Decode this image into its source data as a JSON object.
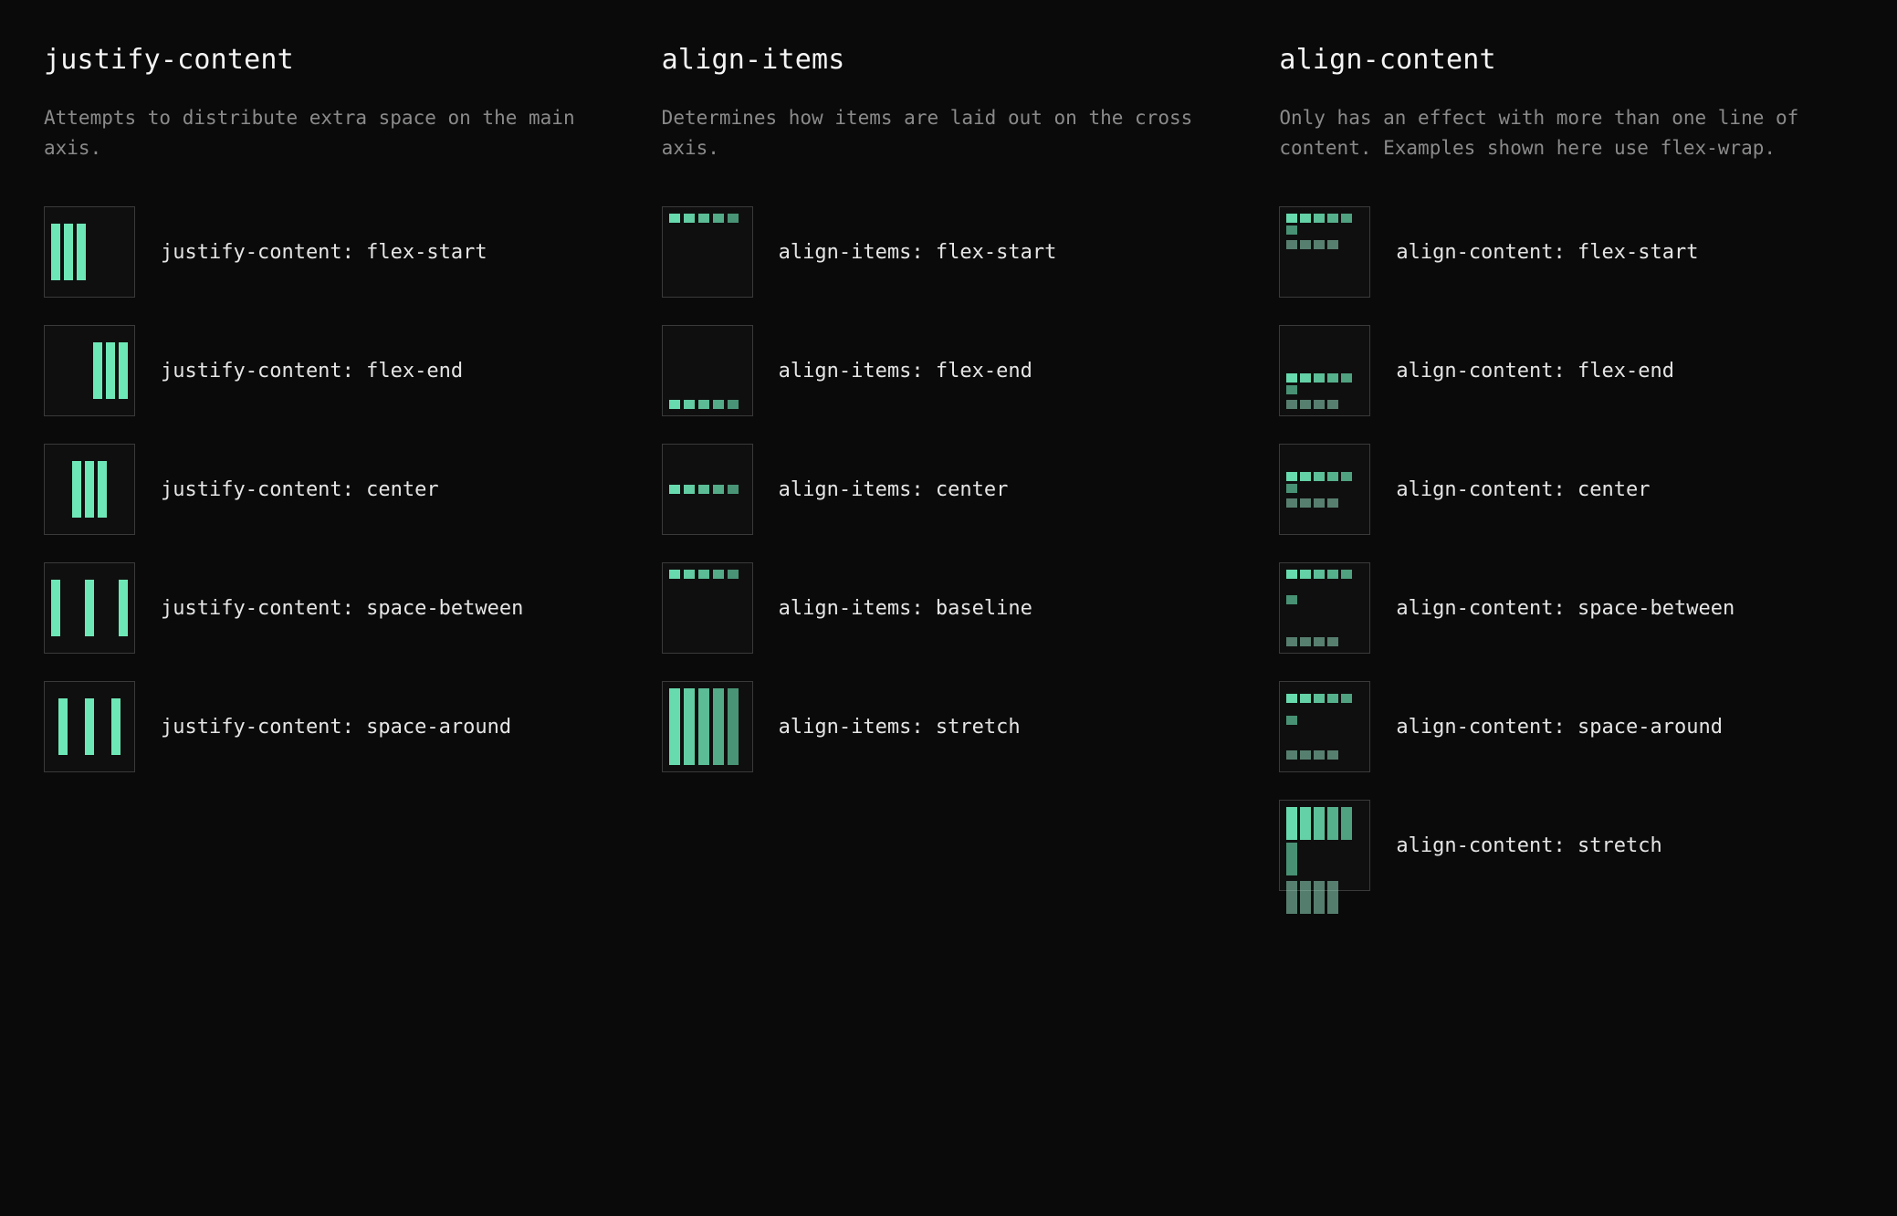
{
  "columns": {
    "justify_content": {
      "title": "justify-content",
      "description": "Attempts to distribute extra space on the main axis.",
      "items": [
        {
          "label": "justify-content: flex-start"
        },
        {
          "label": "justify-content: flex-end"
        },
        {
          "label": "justify-content: center"
        },
        {
          "label": "justify-content: space-between"
        },
        {
          "label": "justify-content: space-around"
        }
      ]
    },
    "align_items": {
      "title": "align-items",
      "description": "Determines how items are laid out on the cross axis.",
      "items": [
        {
          "label": "align-items: flex-start"
        },
        {
          "label": "align-items: flex-end"
        },
        {
          "label": "align-items: center"
        },
        {
          "label": "align-items: baseline"
        },
        {
          "label": "align-items: stretch"
        }
      ]
    },
    "align_content": {
      "title": "align-content",
      "description": "Only has an effect with more than one line of content. Examples shown here use flex-wrap.",
      "items": [
        {
          "label": "align-content: flex-start"
        },
        {
          "label": "align-content: flex-end"
        },
        {
          "label": "align-content: center"
        },
        {
          "label": "align-content: space-between"
        },
        {
          "label": "align-content: space-around"
        },
        {
          "label": "align-content: stretch"
        }
      ]
    }
  },
  "colors": {
    "background": "#0a0a0a",
    "text": "#e5e5e5",
    "muted": "#8a8a8a",
    "accent": "#6ee7b7",
    "border": "#3a3a3a"
  }
}
